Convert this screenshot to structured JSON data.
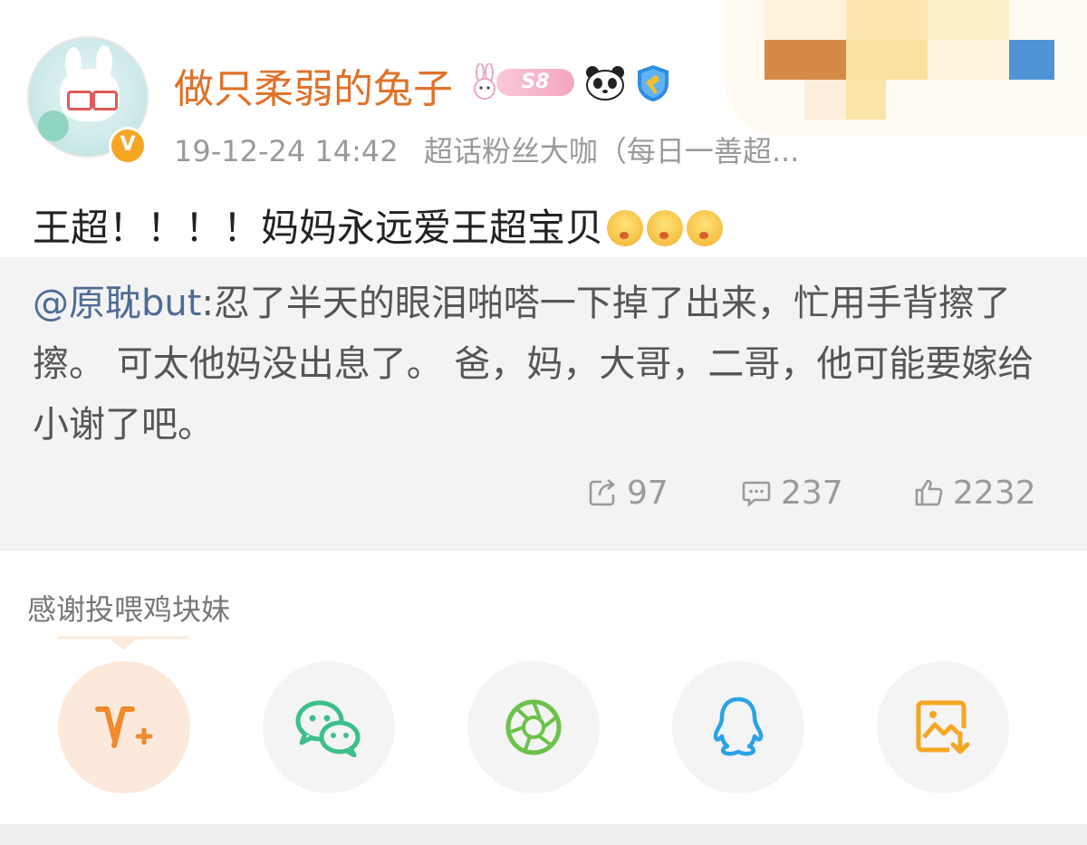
{
  "user": {
    "name": "做只柔弱的兔子",
    "level_badge": "S8",
    "timestamp": "19-12-24 14:42",
    "source": "超话粉丝大咖（每日一善超..."
  },
  "post": {
    "text": "王超！！！！妈妈永远爱王超宝贝",
    "emoji_count": 3
  },
  "quote": {
    "mention": "@原耽but",
    "text": ":忍了半天的眼泪啪嗒一下掉了出来，忙用手背擦了擦。 可太他妈没出息了。 爸，妈，大哥，二哥，他可能要嫁给小谢了吧。"
  },
  "stats": {
    "reposts": "97",
    "comments": "237",
    "likes": "2232"
  },
  "share": {
    "label": "感谢投喂鸡块妹",
    "targets": [
      {
        "name": "weibo-vplus",
        "icon": "v-plus-icon",
        "color": "#f08a2c"
      },
      {
        "name": "wechat",
        "icon": "wechat-icon",
        "color": "#3cc08a"
      },
      {
        "name": "moments",
        "icon": "moments-icon",
        "color": "#6cc24a"
      },
      {
        "name": "qq",
        "icon": "qq-icon",
        "color": "#2aa3e6"
      },
      {
        "name": "save-image",
        "icon": "save-image-icon",
        "color": "#f5a623"
      }
    ]
  },
  "colors": {
    "username": "#e0712a",
    "mention": "#4e6b96",
    "quote_bg": "#f3f3f3"
  }
}
